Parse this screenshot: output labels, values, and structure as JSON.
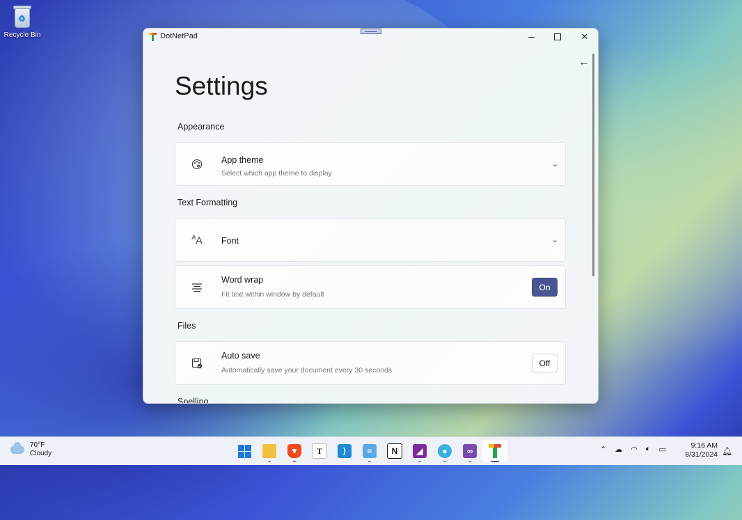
{
  "desktop": {
    "recycle_bin_label": "Recycle Bin"
  },
  "window": {
    "title": "DotNetPad",
    "icons": {
      "minimize": "minimize-icon",
      "maximize": "maximize-icon",
      "close": "close-icon",
      "back": "back-arrow-icon"
    }
  },
  "settings": {
    "page_title": "Settings",
    "sections": {
      "appearance": "Appearance",
      "text_formatting": "Text Formatting",
      "files": "Files",
      "spelling": "Spelling"
    },
    "app_theme": {
      "title": "App theme",
      "description": "Select which app theme to display"
    },
    "font": {
      "title": "Font"
    },
    "word_wrap": {
      "title": "Word wrap",
      "description": "Fit text within window by default",
      "value": "On"
    },
    "auto_save": {
      "title": "Auto save",
      "description": "Automatically save your document every 30 seconds",
      "value": "Off"
    }
  },
  "taskbar": {
    "weather_temp": "70°F",
    "weather_desc": "Cloudy",
    "pinned": [
      "start",
      "file-explorer",
      "brave",
      "typora",
      "vs-code",
      "notepad",
      "notion",
      "affinity",
      "maps",
      "visual-studio",
      "dotnetpad"
    ],
    "clock_time": "9:16 AM",
    "clock_date": "8/31/2024"
  },
  "colors": {
    "accent": "#4a5690"
  }
}
